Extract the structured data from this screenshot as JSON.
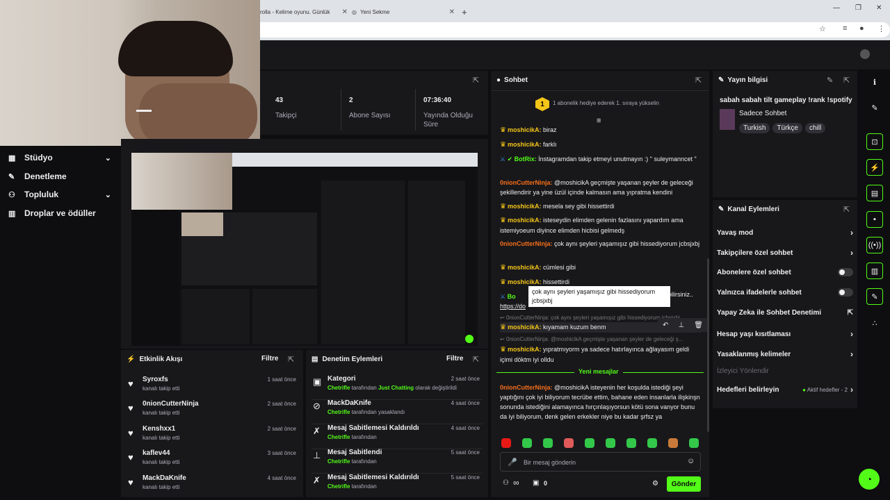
{
  "browser": {
    "tab1_title": "rolla - Kelime oyunu. Günlük",
    "tab2_title": "Yeni Sekme"
  },
  "sidebar": {
    "items": [
      {
        "label": "Stüdyo",
        "icon": "dashboard-icon"
      },
      {
        "label": "Denetleme",
        "icon": "wrench-icon"
      },
      {
        "label": "Topluluk",
        "icon": "users-icon"
      },
      {
        "label": "Droplar ve ödüller",
        "icon": "chart-icon"
      }
    ]
  },
  "stats": [
    {
      "value": "43",
      "label": "Takipçi"
    },
    {
      "value": "2",
      "label": "Abone Sayısı"
    },
    {
      "value": "07:36:40",
      "label": "Yayında Olduğu Süre"
    }
  ],
  "activity": {
    "title": "Etkinlik Akışı",
    "filter": "Filtre",
    "items": [
      {
        "name": "Syroxfs",
        "action": "kanalı takip etti",
        "time": "1 saat önce"
      },
      {
        "name": "0nionCutterNinja",
        "action": "kanalı takip etti",
        "time": "2 saat önce"
      },
      {
        "name": "Kenshxx1",
        "action": "kanalı takip etti",
        "time": "2 saat önce"
      },
      {
        "name": "kaflev44",
        "action": "kanalı takip etti",
        "time": "3 saat önce"
      },
      {
        "name": "MackDaKnife",
        "action": "kanalı takip etti",
        "time": "4 saat önce"
      }
    ]
  },
  "moderation": {
    "title": "Denetim Eylemleri",
    "filter": "Filtre",
    "items": [
      {
        "title": "Kategori",
        "actor": "Chetrifle",
        "mid": "tarafından",
        "extra": "Just Chatting",
        "tail": "olarak değiştirildi",
        "time": "2 saat önce"
      },
      {
        "title": "MackDaKnife",
        "actor": "Chetrifle",
        "mid": "tarafından yasaklandı",
        "extra": "",
        "tail": "",
        "time": "4 saat önce"
      },
      {
        "title": "Mesaj Sabitlemesi Kaldırıldı",
        "actor": "Chetrifle",
        "mid": "tarafından",
        "extra": "",
        "tail": "",
        "time": "4 saat önce"
      },
      {
        "title": "Mesaj Sabitlendi",
        "actor": "Chetrifle",
        "mid": "tarafından",
        "extra": "",
        "tail": "",
        "time": "5 saat önce"
      },
      {
        "title": "Mesaj Sabitlemesi Kaldırıldı",
        "actor": "Chetrifle",
        "mid": "tarafından",
        "extra": "",
        "tail": "",
        "time": "5 saat önce"
      }
    ]
  },
  "chat": {
    "title": "Sohbet",
    "gift_banner": "1 abonelik hediye ederek 1. sıraya yükselin",
    "gift_count": "1",
    "messages": [
      {
        "user": "moshicikA",
        "text": "biraz"
      },
      {
        "user": "moshicikA",
        "text": "farklı"
      },
      {
        "user": "BotRix",
        "text": "İnstagramdan takip etmeyi unutmayın :) \" suleymanncet \""
      },
      {
        "user": "0nionCutterNinja",
        "text": "@moshicikA geçmişte yaşanan şeyler de geleceği şekillendirir ya yine üzül içinde kalmasın ama yıpratma kendini"
      },
      {
        "user": "moshicikA",
        "text": "mesela sey gibi hissettirdi"
      },
      {
        "user": "moshicikA",
        "text": "isteseydin elimden gelenin fazlasını yapardım ama istemiyoeum diyince elimden hicbisi gelmedş"
      },
      {
        "user": "0nionCutterNinja",
        "text": "çok aynı şeyleri yaşamışız gibi hissediyorum jcbsjxbj"
      },
      {
        "user": "moshicikA",
        "text": "cümlesi gibi"
      },
      {
        "user": "moshicikA",
        "text": "hissettirdi"
      },
      {
        "user": "Bo",
        "text": "https://do"
      },
      {
        "user": "moshicikA",
        "text": "kıyamam kuzum benm"
      },
      {
        "user": "moshicikA",
        "text": "yıpratmıyorm ya sadece hatırlayınca ağlayasım geldi içimi döktm iyi olldu"
      },
      {
        "user": "0nionCutterNinja",
        "text": "@moshicikA isteyenin her koşulda istediği şeyi yaptığını çok iyi biliyorum tecrübe ettim, bahane eden insanlarla ilişkinşn sonunda istediğini alamayınca hırçınlaşıyorsun kötü sona vanyor bunu da iyi biliyorum, denk gelen erkekler niye bu kadar şrfsz ya"
      }
    ],
    "tooltip": "çok aynı şeyleri yaşamışız gibi hissediyorum jcbsjxbj",
    "tooltip_tail": "bilirsiniz..",
    "reply1": "0nionCutterNinja: çok aynı şeyleri yaşamışız gibi hissediyorum jcbsjxbj",
    "reply2": "0nionCutterNinja: @moshicikA geçmişte yaşanan şeyler de geleceği ş...",
    "new_messages": "Yeni mesajlar",
    "input_placeholder": "Bir mesaj gönderin",
    "infinity": "∞",
    "gift_total": "0",
    "send_label": "Gönder"
  },
  "stream_info": {
    "title": "Yayın bilgisi",
    "stream_title": "sabah sabah tilt gameplay !rank !spotify",
    "category": "Sadece Sohbet",
    "tags": [
      "Turkish",
      "Türkçe",
      "chill"
    ]
  },
  "channel_actions": {
    "title": "Kanal Eylemleri",
    "items": [
      {
        "label": "Yavaş mod",
        "control": "chevron"
      },
      {
        "label": "Takipçilere özel sohbet",
        "control": "chevron"
      },
      {
        "label": "Abonelere özel sohbet",
        "control": "toggle"
      },
      {
        "label": "Yalnızca ifadelerle sohbet",
        "control": "toggle"
      },
      {
        "label": "Yapay Zeka ile Sohbet Denetimi",
        "control": "external"
      },
      {
        "label": "Hesap yaşı kısıtlaması",
        "control": "chevron"
      },
      {
        "label": "Yasaklanmış kelimeler",
        "control": "chevron"
      },
      {
        "label": "İzleyici Yönlendir",
        "control": "none"
      },
      {
        "label": "Hedefleri belirleyin",
        "control": "chevron"
      }
    ],
    "goals_status": "Aktif hedefler - 2"
  },
  "colors": {
    "accent": "#53fc18",
    "background": "#0e0e10",
    "panel": "#18181b"
  }
}
